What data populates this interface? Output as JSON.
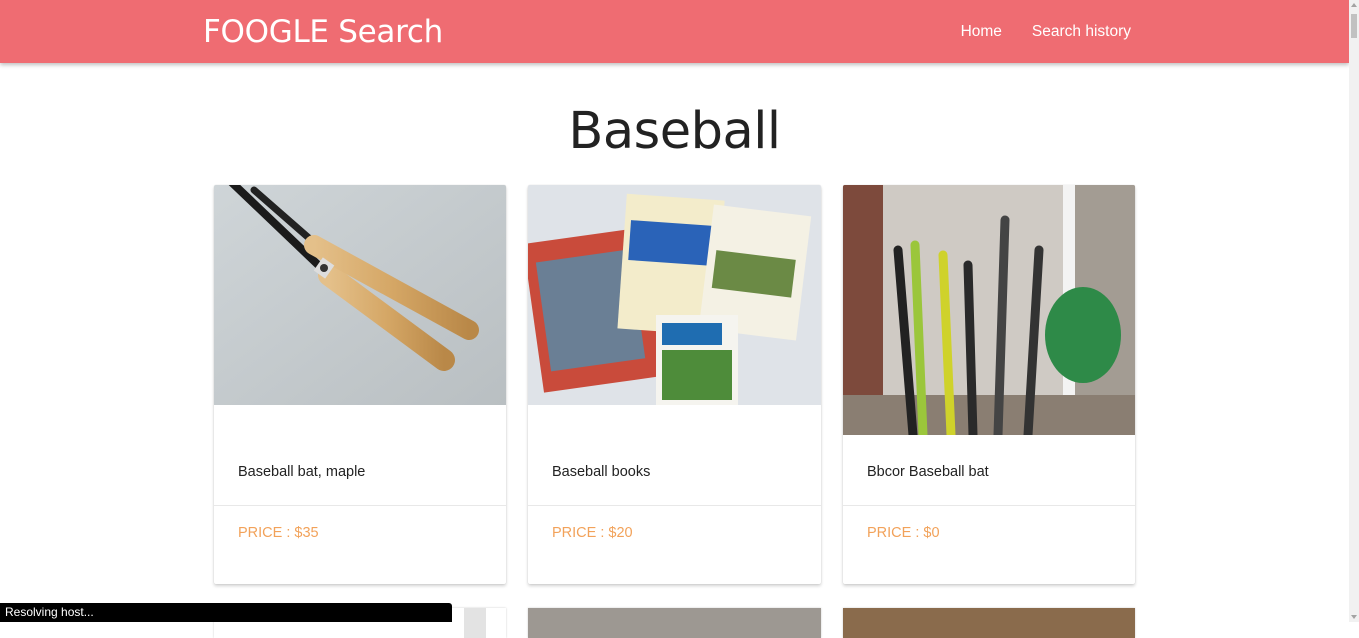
{
  "brand": "FOOGLE Search",
  "nav": {
    "home": "Home",
    "history": "Search history"
  },
  "page_title": "Baseball",
  "cards": [
    {
      "title": "Baseball bat, maple",
      "price": "PRICE : $35",
      "image": "baseball-bats-photo"
    },
    {
      "title": "Baseball books",
      "price": "PRICE : $20",
      "image": "baseball-books-photo"
    },
    {
      "title": "Bbcor Baseball bat",
      "price": "PRICE : $0",
      "image": "bats-against-wall-photo"
    }
  ],
  "status": "Resolving host...",
  "colors": {
    "navbar": "#ef6c72",
    "price": "#f2a25a"
  }
}
